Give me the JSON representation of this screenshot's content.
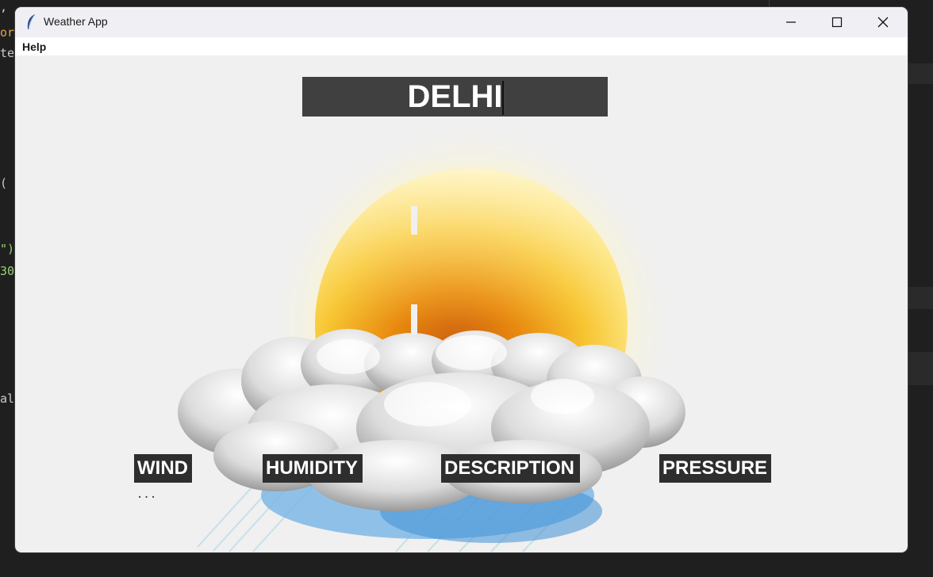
{
  "window": {
    "title": "Weather App",
    "icon": "feather-icon"
  },
  "menu": {
    "help_label": "Help"
  },
  "city": {
    "value": "DELHI"
  },
  "readouts": {
    "temperature_top": "",
    "temperature_mid": ""
  },
  "labels": {
    "wind": "WIND",
    "humidity": "HUMIDITY",
    "description": "DESCRIPTION",
    "pressure": "PRESSURE"
  },
  "values": {
    "wind": "...",
    "humidity": "",
    "description": "",
    "pressure": ""
  },
  "background_code": {
    "lines": [
      ", ",
      "or",
      "te",
      "(",
      "\")",
      "30",
      "al"
    ]
  },
  "colors": {
    "input_bg": "#404040",
    "label_bg": "#2e2e2e",
    "window_bg": "#f0f0f0",
    "sun_core": "#f5a716"
  }
}
